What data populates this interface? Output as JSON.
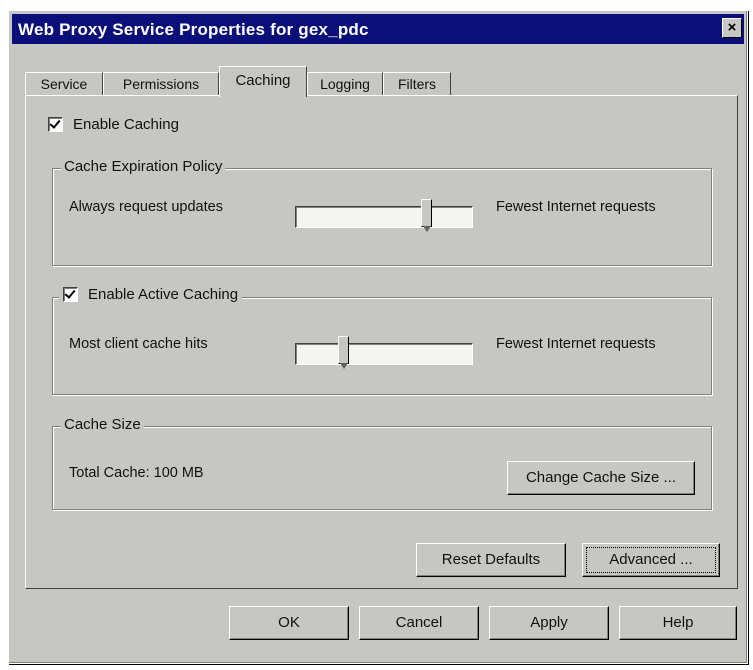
{
  "window": {
    "title": "Web Proxy Service Properties for gex_pdc",
    "close_label": "×"
  },
  "tabs": [
    {
      "label": "Service",
      "active": false
    },
    {
      "label": "Permissions",
      "active": false
    },
    {
      "label": "Caching",
      "active": true
    },
    {
      "label": "Logging",
      "active": false
    },
    {
      "label": "Filters",
      "active": false
    }
  ],
  "caching": {
    "enable_caching": {
      "label": "Enable Caching",
      "checked": true
    },
    "expiration_policy": {
      "group_label": "Cache Expiration Policy",
      "left_label": "Always request updates",
      "right_label": "Fewest Internet requests",
      "slider_level": 0.75
    },
    "active_caching": {
      "checkbox_label": "Enable Active Caching",
      "checked": true,
      "left_label": "Most client cache hits",
      "right_label": "Fewest Internet requests",
      "slider_level": 0.3
    },
    "cache_size": {
      "group_label": "Cache Size",
      "total_label": "Total Cache: 100 MB",
      "change_button": "Change Cache Size ..."
    },
    "reset_defaults_button": "Reset Defaults",
    "advanced_button": "Advanced ..."
  },
  "footer": {
    "ok": "OK",
    "cancel": "Cancel",
    "apply": "Apply",
    "help": "Help"
  }
}
